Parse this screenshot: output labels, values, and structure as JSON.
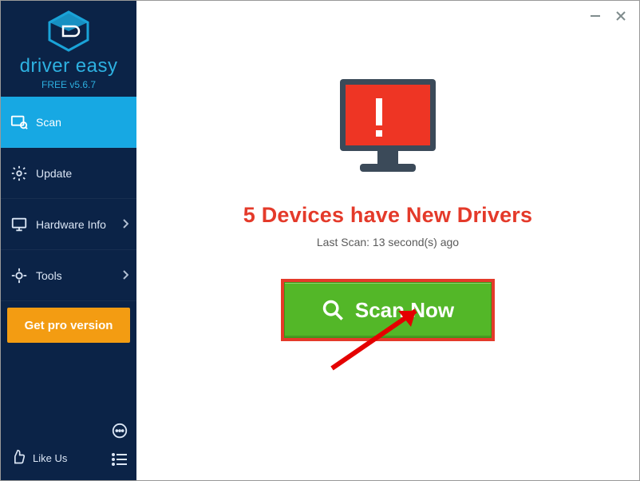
{
  "brand": {
    "name": "driver easy",
    "version": "FREE v5.6.7"
  },
  "sidebar": {
    "items": [
      {
        "label": "Scan"
      },
      {
        "label": "Update"
      },
      {
        "label": "Hardware Info"
      },
      {
        "label": "Tools"
      }
    ],
    "pro_label": "Get pro version",
    "like_label": "Like Us"
  },
  "main": {
    "headline": "5 Devices have New Drivers",
    "subline": "Last Scan: 13 second(s) ago",
    "scan_label": "Scan Now"
  },
  "colors": {
    "sidebar_bg": "#0b2347",
    "accent": "#17a8e3",
    "pro": "#f39c12",
    "alert": "#e43a2a",
    "scan": "#53b728"
  }
}
